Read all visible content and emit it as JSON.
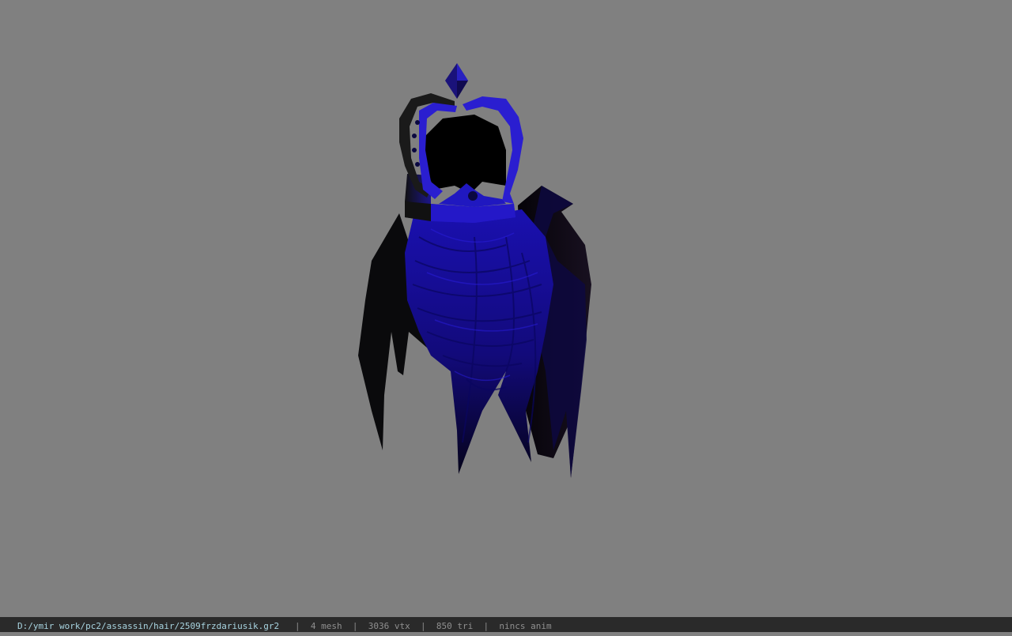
{
  "viewport": {
    "background": "#808080",
    "model_colors": {
      "hair": "#1c10a0",
      "hair_dark": "#0a0630",
      "crown": "#2a1ec8",
      "crown_dark": "#0b0b20",
      "shadow": "#000000"
    }
  },
  "statusbar": {
    "file_path": "D:/ymir work/pc2/assassin/hair/2509frzdariusik.gr2",
    "separator": "|",
    "mesh": "4 mesh",
    "vtx": "3036 vtx",
    "tri": "850 tri",
    "anim": "nincs anim"
  }
}
